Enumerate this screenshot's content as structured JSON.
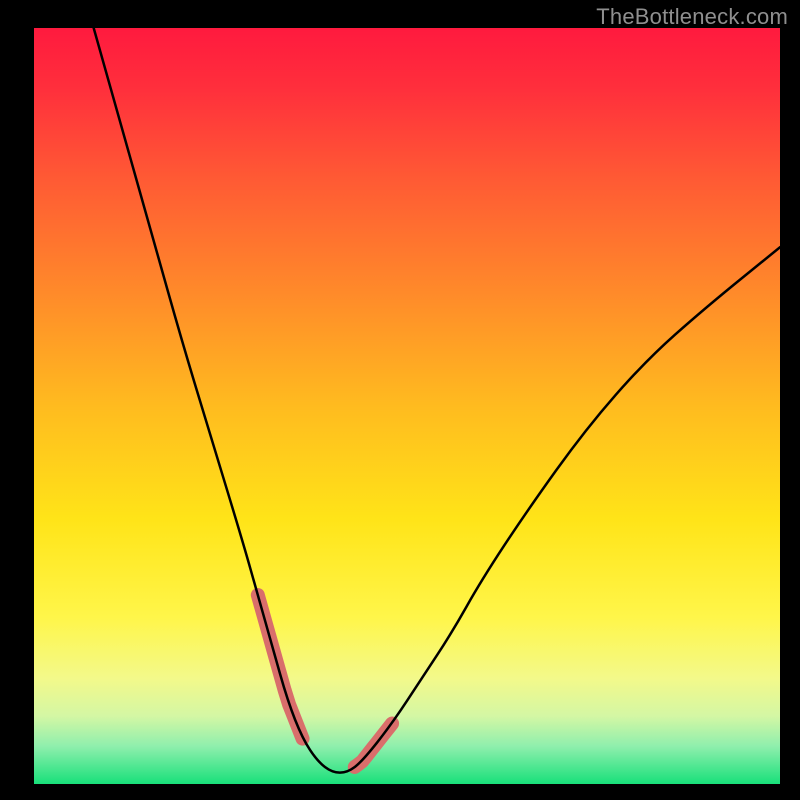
{
  "watermark": "TheBottleneck.com",
  "chart_data": {
    "type": "line",
    "title": "",
    "xlabel": "",
    "ylabel": "",
    "xlim": [
      0,
      100
    ],
    "ylim": [
      0,
      100
    ],
    "series": [
      {
        "name": "curve",
        "x": [
          8,
          12,
          16,
          20,
          24,
          28,
          30,
          32,
          34,
          36,
          38,
          40,
          42,
          44,
          48,
          52,
          56,
          60,
          66,
          74,
          82,
          90,
          100
        ],
        "y": [
          100,
          86,
          72,
          58,
          45,
          32,
          25,
          18,
          11,
          6,
          3,
          1.5,
          1.5,
          3,
          8,
          14,
          20,
          27,
          36,
          47,
          56,
          63,
          71
        ]
      }
    ],
    "highlight_segments": [
      {
        "from_x": 30,
        "to_x": 36
      },
      {
        "from_x": 43,
        "to_x": 48
      }
    ],
    "gradient_stops": [
      {
        "offset": 0.0,
        "color": "#ff1a3e"
      },
      {
        "offset": 0.08,
        "color": "#ff2f3c"
      },
      {
        "offset": 0.2,
        "color": "#ff5a34"
      },
      {
        "offset": 0.35,
        "color": "#ff8a2a"
      },
      {
        "offset": 0.5,
        "color": "#ffbb1f"
      },
      {
        "offset": 0.65,
        "color": "#ffe418"
      },
      {
        "offset": 0.78,
        "color": "#fff64a"
      },
      {
        "offset": 0.86,
        "color": "#f3f98a"
      },
      {
        "offset": 0.91,
        "color": "#d4f7a4"
      },
      {
        "offset": 0.95,
        "color": "#8fefad"
      },
      {
        "offset": 1.0,
        "color": "#18e07a"
      }
    ],
    "curve_color": "#000000",
    "highlight_color": "#d96e6b"
  }
}
